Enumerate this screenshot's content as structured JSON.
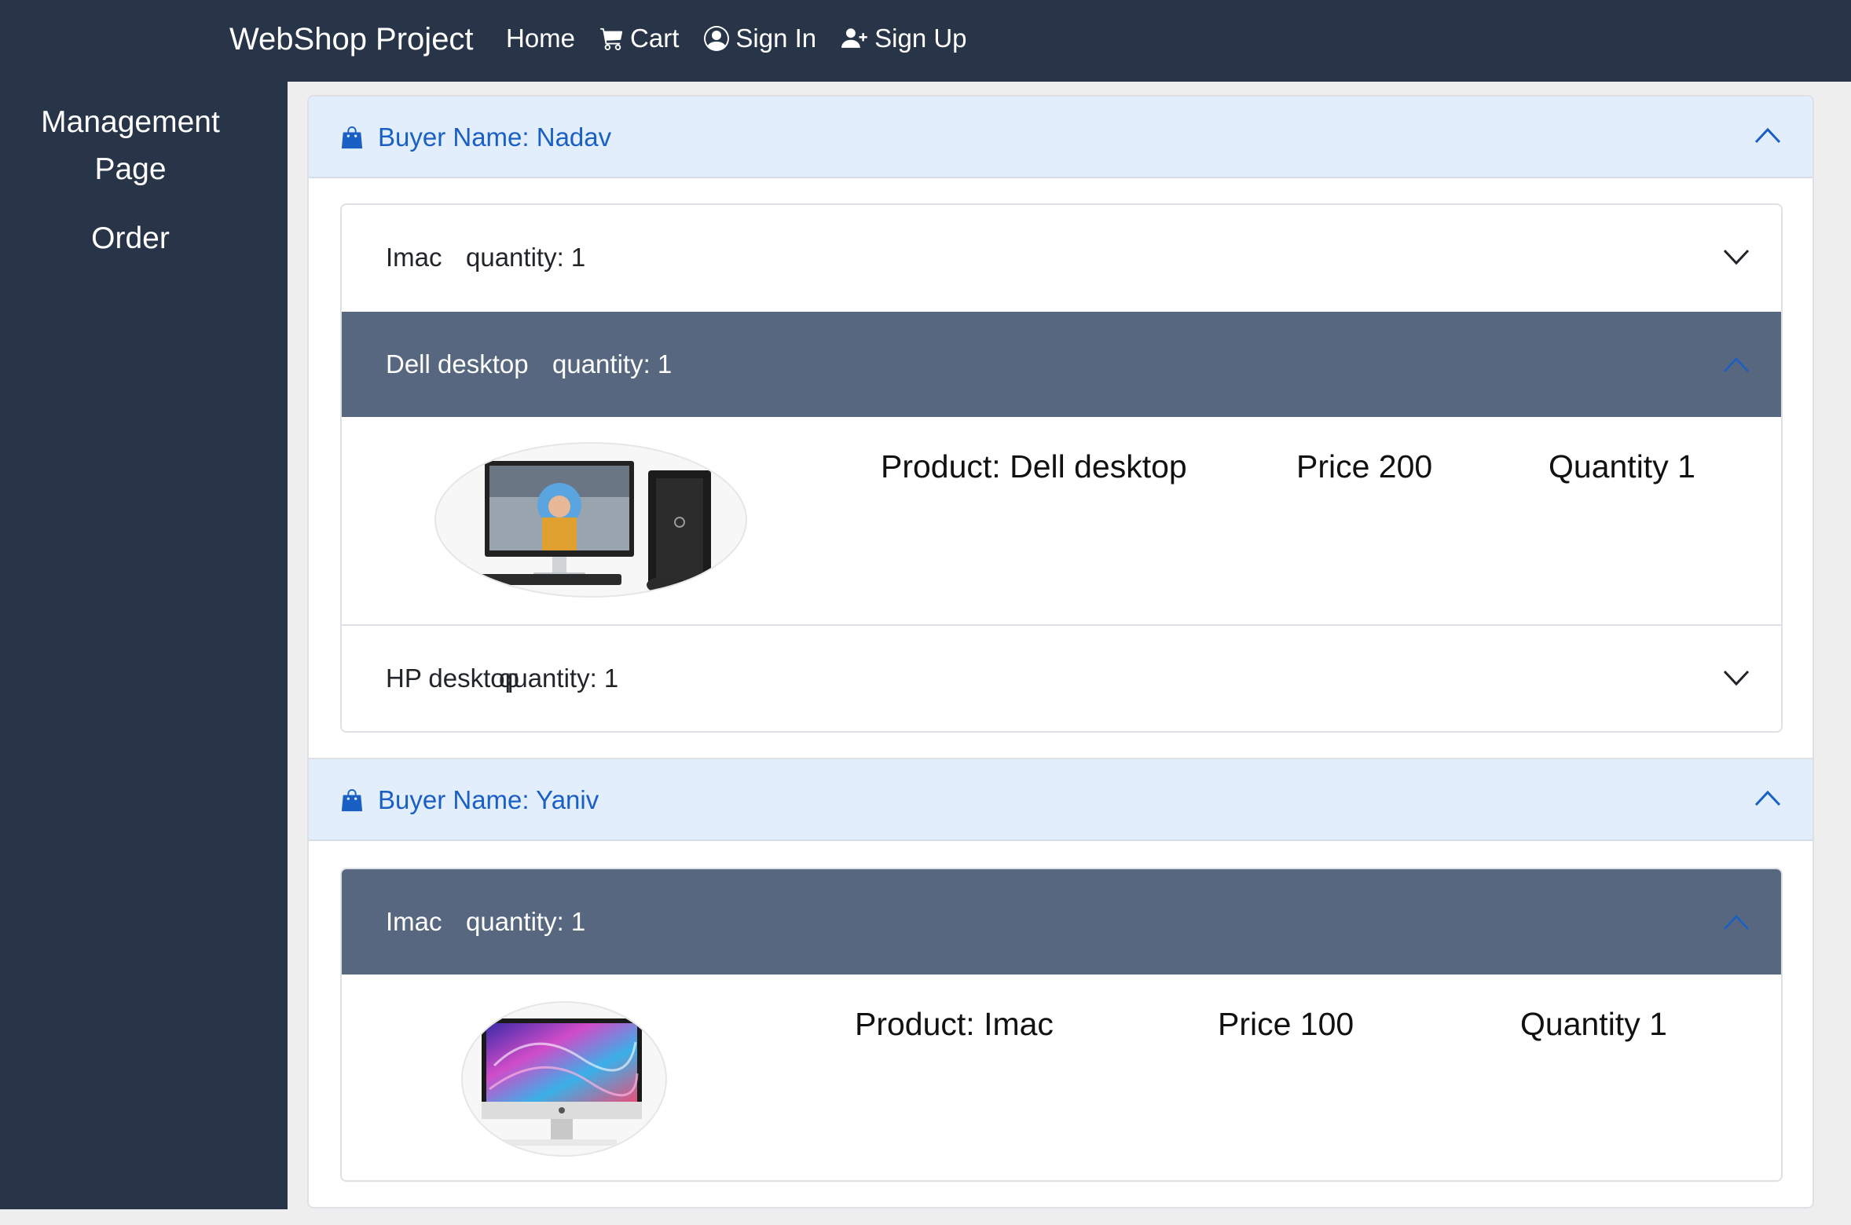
{
  "navbar": {
    "brand": "WebShop Project",
    "links": {
      "home": "Home",
      "cart": "Cart",
      "sign_in": "Sign In",
      "sign_up": "Sign Up"
    }
  },
  "sidebar": {
    "title_line1": "Management",
    "title_line2": "Page",
    "order": "Order"
  },
  "colors": {
    "navbar_bg": "#283447",
    "accordion_open_bg": "#56677f",
    "buyer_header_bg": "#e3eefc",
    "buyer_text": "#1a5fc4"
  },
  "orders": [
    {
      "buyer_label": "Buyer Name: Nadav",
      "items": [
        {
          "name": "Imac",
          "quantity_label": "quantity: 1",
          "expanded": false
        },
        {
          "name": "Dell desktop",
          "quantity_label": "quantity: 1",
          "expanded": true,
          "product_label": "Product: Dell desktop",
          "price_label": "Price 200",
          "quantity_detail": "Quantity 1",
          "image_icon": "dell-desktop-image"
        },
        {
          "name": "HP desktop",
          "quantity_label": "quantity: 1",
          "expanded": false
        }
      ]
    },
    {
      "buyer_label": "Buyer Name: Yaniv",
      "items": [
        {
          "name": "Imac",
          "quantity_label": "quantity: 1",
          "expanded": true,
          "product_label": "Product: Imac",
          "price_label": "Price 100",
          "quantity_detail": "Quantity 1",
          "image_icon": "imac-image"
        }
      ]
    }
  ]
}
